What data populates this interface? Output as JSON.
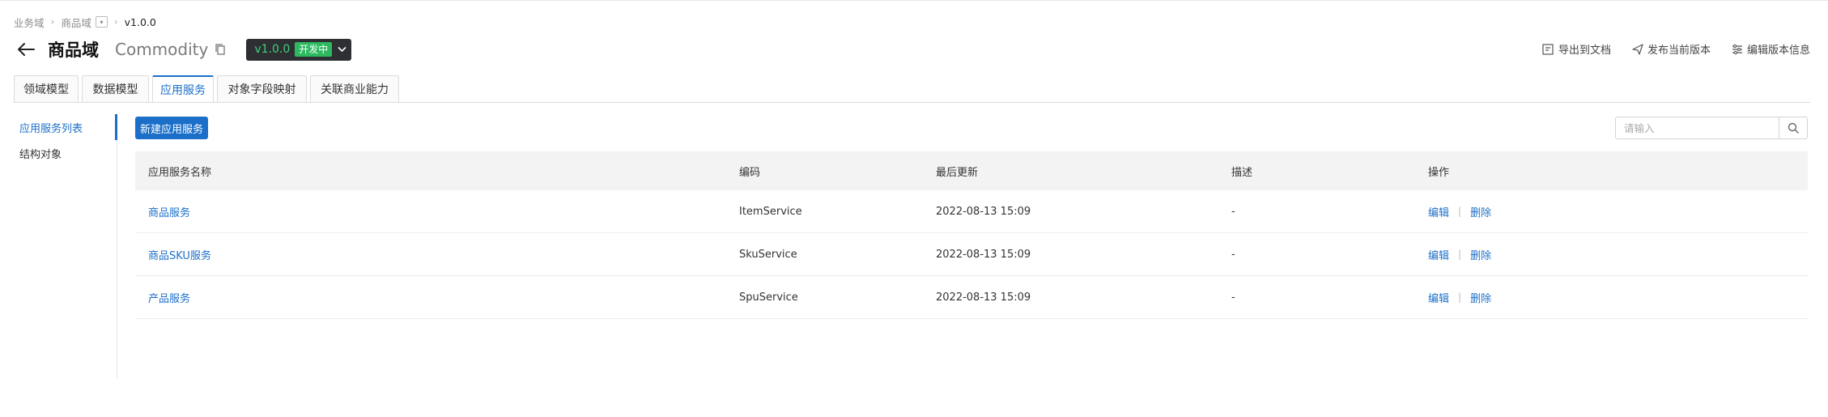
{
  "breadcrumb": {
    "item1": "业务域",
    "item2": "商品域",
    "current": "v1.0.0"
  },
  "header": {
    "title_cn": "商品域",
    "title_en": "Commodity",
    "version": "v1.0.0",
    "status": "开发中"
  },
  "actions": {
    "export": "导出到文档",
    "publish": "发布当前版本",
    "edit_info": "编辑版本信息"
  },
  "tabs": [
    {
      "label": "领域模型"
    },
    {
      "label": "数据模型"
    },
    {
      "label": "应用服务"
    },
    {
      "label": "对象字段映射"
    },
    {
      "label": "关联商业能力"
    }
  ],
  "sidebar": {
    "items": [
      {
        "label": "应用服务列表"
      },
      {
        "label": "结构对象"
      }
    ]
  },
  "main": {
    "new_button": "新建应用服务",
    "search_placeholder": "请输入"
  },
  "table": {
    "headers": {
      "name": "应用服务名称",
      "code": "编码",
      "updated": "最后更新",
      "desc": "描述",
      "ops": "操作"
    },
    "rows": [
      {
        "name": "商品服务",
        "code": "ItemService",
        "updated": "2022-08-13 15:09",
        "desc": "-",
        "edit": "编辑",
        "delete": "删除"
      },
      {
        "name": "商品SKU服务",
        "code": "SkuService",
        "updated": "2022-08-13 15:09",
        "desc": "-",
        "edit": "编辑",
        "delete": "删除"
      },
      {
        "name": "产品服务",
        "code": "SpuService",
        "updated": "2022-08-13 15:09",
        "desc": "-",
        "edit": "编辑",
        "delete": "删除"
      }
    ]
  },
  "colors": {
    "accent": "#1b6fc9",
    "status_green": "#2db95e",
    "chip_bg": "#2d2f33"
  }
}
